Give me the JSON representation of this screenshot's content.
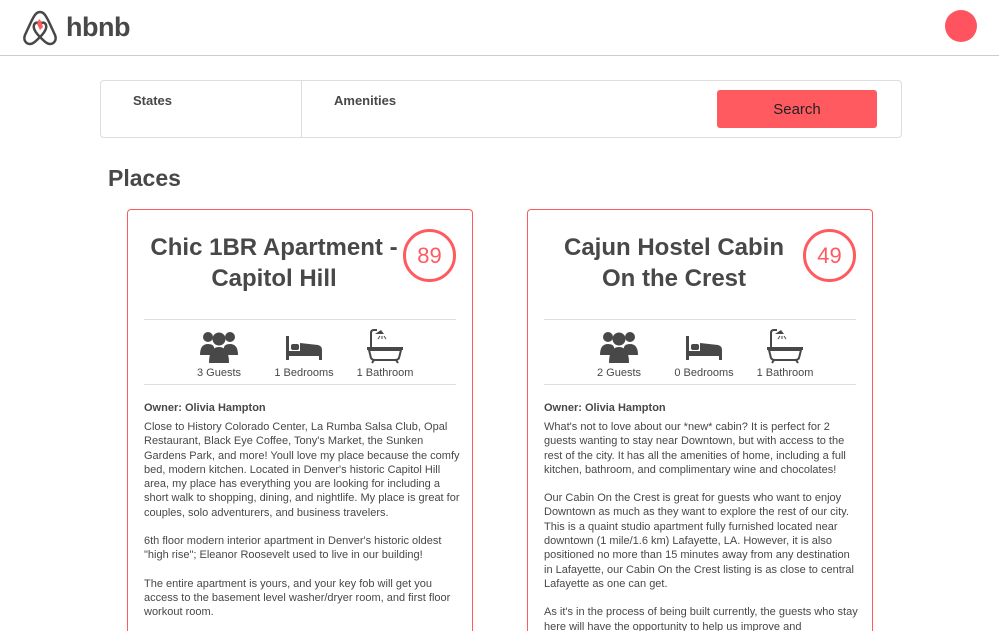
{
  "header": {
    "brand": "hbnb",
    "logo_icon": "airbnb-logo-icon",
    "status_color": "#ff545f"
  },
  "filters": {
    "states_label": "States",
    "amenities_label": "Amenities",
    "search_label": "Search",
    "search_color": "#ff5a5f"
  },
  "places": {
    "title": "Places",
    "items": [
      {
        "name_line1": "Chic 1BR Apartment -",
        "name_line2": "Capitol Hill",
        "price": "89",
        "guests": "3 Guests",
        "bedrooms": "1 Bedrooms",
        "bathrooms": "1 Bathroom",
        "owner": "Owner: Olivia Hampton",
        "description": [
          "Close to History Colorado Center, La Rumba Salsa Club, Opal Restaurant, Black Eye Coffee, Tony's Market, the Sunken Gardens Park, and more! Youll love my place because the comfy bed, modern kitchen. Located in Denver's historic Capitol Hill area, my place has everything you are looking for including a short walk to shopping, dining, and nightlife. My place is great for couples, solo adventurers, and business travelers.",
          "6th floor modern interior apartment in Denver's historic oldest \"high rise\"; Eleanor Roosevelt used to live in our building!",
          "The entire apartment is yours, and your key fob will get you access to the basement level washer/dryer room, and first floor workout room."
        ]
      },
      {
        "name_line1": "Cajun Hostel Cabin",
        "name_line2": "On the Crest",
        "price": "49",
        "guests": "2 Guests",
        "bedrooms": "0 Bedrooms",
        "bathrooms": "1 Bathroom",
        "owner": "Owner: Olivia Hampton",
        "description": [
          "What's not to love about our *new* cabin? It is perfect for 2 guests wanting to stay near Downtown, but with access to the rest of the city. It has all the amenities of home, including a full kitchen, bathroom, and complimentary wine and chocolates!",
          "Our Cabin On the Crest is great for guests who want to enjoy Downtown as much as they want to explore the rest of our city. This is a quaint studio apartment fully furnished located near downtown (1 mile/1.6 km) Lafayette, LA. However, it is also positioned no more than 15 minutes away from any destination in Lafayette, our Cabin On the Crest listing is as close to central Lafayette as one can get.",
          "As it's in the process of being built currently, the guests who stay here will have the opportunity to help us improve and"
        ]
      }
    ]
  },
  "icons": {
    "guests": "guests-icon",
    "bedrooms": "bed-icon",
    "bathrooms": "bathtub-icon"
  }
}
